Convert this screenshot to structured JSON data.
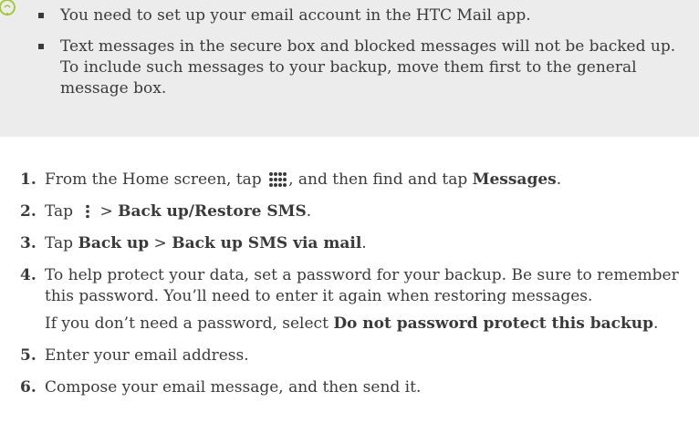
{
  "note": {
    "bullets": [
      "You need to set up your email account in the HTC Mail app.",
      "Text messages in the secure box and blocked messages will not be backed up. To include such messages to your backup, move them first to the general message box."
    ]
  },
  "steps": [
    {
      "num": "1.",
      "a": "From the Home screen, tap",
      "b": ", and then find and tap",
      "c": "Messages",
      "d": "."
    },
    {
      "num": "2.",
      "a": "Tap",
      "b": ">",
      "c": "Back up/Restore SMS",
      "d": "."
    },
    {
      "num": "3.",
      "a": "Tap",
      "b": "Back up",
      "c": ">",
      "d": "Back up SMS via mail",
      "e": "."
    },
    {
      "num": "4.",
      "a": "To help protect your data, set a password for your backup. Be sure to remember this password. You’ll need to enter it again when restoring messages.",
      "sub_a": "If you don’t need a password, select",
      "sub_b": "Do not password protect this backup",
      "sub_c": "."
    },
    {
      "num": "5.",
      "a": "Enter your email address."
    },
    {
      "num": "6.",
      "a": "Compose your email message, and then send it."
    }
  ],
  "icons": {
    "tip": "lightbulb-icon",
    "apps": "all-apps-icon",
    "menu": "overflow-menu-icon"
  },
  "colors": {
    "note_bg": "#ececec",
    "text": "#3a3a3a",
    "tip_icon": "#a5c93a"
  }
}
